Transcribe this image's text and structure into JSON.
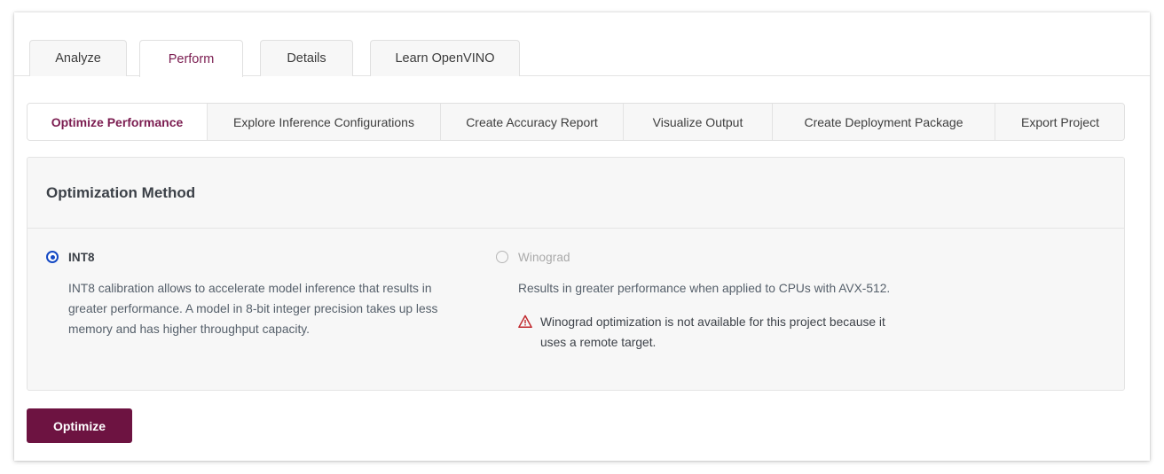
{
  "window": {
    "primary_tabs": [
      {
        "label": "Analyze",
        "active": false
      },
      {
        "label": "Perform",
        "active": true
      },
      {
        "label": "Details",
        "active": false
      },
      {
        "label": "Learn OpenVINO",
        "active": false
      }
    ],
    "secondary_tabs": [
      {
        "label": "Optimize Performance",
        "active": true
      },
      {
        "label": "Explore Inference Configurations",
        "active": false
      },
      {
        "label": "Create Accuracy Report",
        "active": false
      },
      {
        "label": "Visualize Output",
        "active": false
      },
      {
        "label": "Create Deployment Package",
        "active": false
      },
      {
        "label": "Export Project",
        "active": false
      }
    ]
  },
  "method_card": {
    "title": "Optimization Method",
    "options": [
      {
        "id": "int8",
        "label": "INT8",
        "selected": true,
        "disabled": false,
        "description": "INT8 calibration allows to accelerate model inference that results in greater performance. A model in 8-bit integer precision takes up less memory and has higher throughput capacity."
      },
      {
        "id": "winograd",
        "label": "Winograd",
        "selected": false,
        "disabled": true,
        "description": "Results in greater performance when applied to CPUs with AVX-512.",
        "warning_icon": "warning-triangle-icon",
        "warning": "Winograd optimization is not available for this project because it uses a remote target."
      }
    ]
  },
  "actions": {
    "optimize_label": "Optimize"
  },
  "colors": {
    "accent": "#7b1c50",
    "button_bg": "#6d1341",
    "radio_selected": "#1449c4",
    "warning": "#c0282d",
    "card_bg": "#f7f7f7",
    "border": "#e0e0e0"
  }
}
